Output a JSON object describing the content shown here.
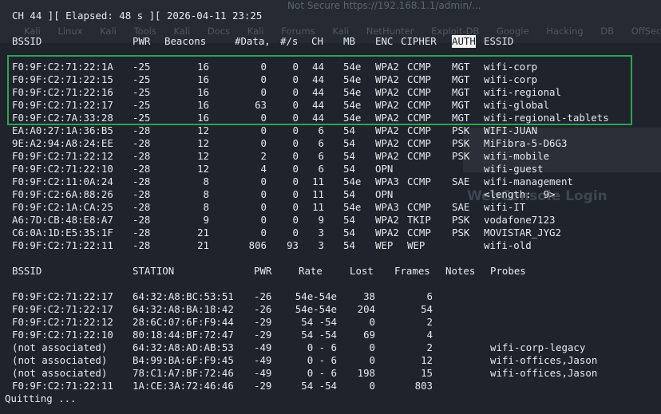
{
  "status_line": "CH 44 ][ Elapsed: 48 s ][ 2026-04-11 23:25",
  "ap_headers": {
    "bssid": "BSSID",
    "pwr": "PWR",
    "beacons": "Beacons",
    "data": "#Data,",
    "per_s": "#/s",
    "ch": "CH",
    "mb": "MB",
    "enc": "ENC",
    "cipher": "CIPHER",
    "auth": "AUTH",
    "essid": "ESSID"
  },
  "aps": [
    {
      "bssid": "F0:9F:C2:71:22:1A",
      "pwr": "-25",
      "beacons": "16",
      "data": "0",
      "per_s": "0",
      "ch": "44",
      "mb": "54e",
      "enc": "WPA2",
      "cipher": "CCMP",
      "auth": "MGT",
      "essid": "wifi-corp"
    },
    {
      "bssid": "F0:9F:C2:71:22:15",
      "pwr": "-25",
      "beacons": "16",
      "data": "0",
      "per_s": "0",
      "ch": "44",
      "mb": "54e",
      "enc": "WPA2",
      "cipher": "CCMP",
      "auth": "MGT",
      "essid": "wifi-corp"
    },
    {
      "bssid": "F0:9F:C2:71:22:16",
      "pwr": "-25",
      "beacons": "16",
      "data": "0",
      "per_s": "0",
      "ch": "44",
      "mb": "54e",
      "enc": "WPA2",
      "cipher": "CCMP",
      "auth": "MGT",
      "essid": "wifi-regional"
    },
    {
      "bssid": "F0:9F:C2:71:22:17",
      "pwr": "-25",
      "beacons": "16",
      "data": "63",
      "per_s": "0",
      "ch": "44",
      "mb": "54e",
      "enc": "WPA2",
      "cipher": "CCMP",
      "auth": "MGT",
      "essid": "wifi-global"
    },
    {
      "bssid": "F0:9F:C2:7A:33:28",
      "pwr": "-25",
      "beacons": "16",
      "data": "0",
      "per_s": "0",
      "ch": "44",
      "mb": "54e",
      "enc": "WPA2",
      "cipher": "CCMP",
      "auth": "MGT",
      "essid": "wifi-regional-tablets"
    },
    {
      "bssid": "EA:A0:27:1A:36:B5",
      "pwr": "-28",
      "beacons": "12",
      "data": "0",
      "per_s": "0",
      "ch": "6",
      "mb": "54",
      "enc": "WPA2",
      "cipher": "CCMP",
      "auth": "PSK",
      "essid": "WIFI-JUAN"
    },
    {
      "bssid": "9E:A2:94:A8:24:EE",
      "pwr": "-28",
      "beacons": "12",
      "data": "0",
      "per_s": "0",
      "ch": "6",
      "mb": "54",
      "enc": "WPA2",
      "cipher": "CCMP",
      "auth": "PSK",
      "essid": "MiFibra-5-D6G3"
    },
    {
      "bssid": "F0:9F:C2:71:22:12",
      "pwr": "-28",
      "beacons": "12",
      "data": "2",
      "per_s": "0",
      "ch": "6",
      "mb": "54",
      "enc": "WPA2",
      "cipher": "CCMP",
      "auth": "PSK",
      "essid": "wifi-mobile"
    },
    {
      "bssid": "F0:9F:C2:71:22:10",
      "pwr": "-28",
      "beacons": "12",
      "data": "4",
      "per_s": "0",
      "ch": "6",
      "mb": "54",
      "enc": "OPN",
      "cipher": "",
      "auth": "",
      "essid": "wifi-guest"
    },
    {
      "bssid": "F0:9F:C2:11:0A:24",
      "pwr": "-28",
      "beacons": "8",
      "data": "0",
      "per_s": "0",
      "ch": "11",
      "mb": "54e",
      "enc": "WPA3",
      "cipher": "CCMP",
      "auth": "SAE",
      "essid": "wifi-management"
    },
    {
      "bssid": "F0:9F:C2:6A:88:26",
      "pwr": "-28",
      "beacons": "8",
      "data": "0",
      "per_s": "0",
      "ch": "11",
      "mb": "54",
      "enc": "OPN",
      "cipher": "",
      "auth": "",
      "essid": "<length:  9>"
    },
    {
      "bssid": "F0:9F:C2:1A:CA:25",
      "pwr": "-28",
      "beacons": "8",
      "data": "0",
      "per_s": "0",
      "ch": "11",
      "mb": "54e",
      "enc": "WPA3",
      "cipher": "CCMP",
      "auth": "SAE",
      "essid": "wifi-IT"
    },
    {
      "bssid": "A6:7D:CB:48:E8:A7",
      "pwr": "-28",
      "beacons": "9",
      "data": "0",
      "per_s": "0",
      "ch": "9",
      "mb": "54",
      "enc": "WPA2",
      "cipher": "TKIP",
      "auth": "PSK",
      "essid": "vodafone7123"
    },
    {
      "bssid": "C6:0A:1D:E5:35:1F",
      "pwr": "-28",
      "beacons": "21",
      "data": "0",
      "per_s": "0",
      "ch": "3",
      "mb": "54",
      "enc": "WPA2",
      "cipher": "CCMP",
      "auth": "PSK",
      "essid": "MOVISTAR_JYG2"
    },
    {
      "bssid": "F0:9F:C2:71:22:11",
      "pwr": "-28",
      "beacons": "21",
      "data": "806",
      "per_s": "93",
      "ch": "3",
      "mb": "54",
      "enc": "WEP",
      "cipher": "WEP",
      "auth": "",
      "essid": "wifi-old"
    }
  ],
  "st_headers": {
    "bssid": "BSSID",
    "station": "STATION",
    "pwr": "PWR",
    "rate": "Rate",
    "lost": "Lost",
    "frames": "Frames",
    "notes": "Notes",
    "probes": "Probes"
  },
  "stations": [
    {
      "bssid": "F0:9F:C2:71:22:17",
      "station": "64:32:A8:BC:53:51",
      "pwr": "-26",
      "rate": "54e-54e",
      "lost": "38",
      "frames": "6",
      "probes": ""
    },
    {
      "bssid": "F0:9F:C2:71:22:17",
      "station": "64:32:A8:BA:18:42",
      "pwr": "-26",
      "rate": "54e-54e",
      "lost": "204",
      "frames": "54",
      "probes": ""
    },
    {
      "bssid": "F0:9F:C2:71:22:12",
      "station": "28:6C:07:6F:F9:44",
      "pwr": "-29",
      "rate": "54 -54",
      "lost": "0",
      "frames": "2",
      "probes": ""
    },
    {
      "bssid": "F0:9F:C2:71:22:10",
      "station": "80:18:44:BF:72:47",
      "pwr": "-29",
      "rate": "54 -54",
      "lost": "69",
      "frames": "4",
      "probes": ""
    },
    {
      "bssid": "(not associated)",
      "station": "64:32:A8:AD:AB:53",
      "pwr": "-49",
      "rate": "0 - 6",
      "lost": "0",
      "frames": "2",
      "probes": "wifi-corp-legacy"
    },
    {
      "bssid": "(not associated)",
      "station": "B4:99:BA:6F:F9:45",
      "pwr": "-49",
      "rate": "0 - 6",
      "lost": "0",
      "frames": "12",
      "probes": "wifi-offices,Jason"
    },
    {
      "bssid": "(not associated)",
      "station": "78:C1:A7:BF:72:46",
      "pwr": "-49",
      "rate": "0 - 6",
      "lost": "198",
      "frames": "15",
      "probes": "wifi-offices,Jason"
    },
    {
      "bssid": "F0:9F:C2:71:22:11",
      "station": "1A:CE:3A:72:46:46",
      "pwr": "-29",
      "rate": "54 -54",
      "lost": "0",
      "frames": "803",
      "probes": ""
    }
  ],
  "footer": "Quitting ...",
  "background_window": {
    "url_text": "Not Secure   https://192.168.1.1/admin/...",
    "bookmarks": "Kali Linux  Kali Tools  Kali Docs  Kali Forums  Kali NetHunter  Exploit-DB  Google Hacking DB  OffSec",
    "login_text": "WebConsole Login"
  },
  "colors": {
    "terminal_bg": "#1e232c",
    "text": "#e7e9ed",
    "selection_border": "#2ea44f",
    "auth_highlight_bg": "#f1f1f1"
  }
}
